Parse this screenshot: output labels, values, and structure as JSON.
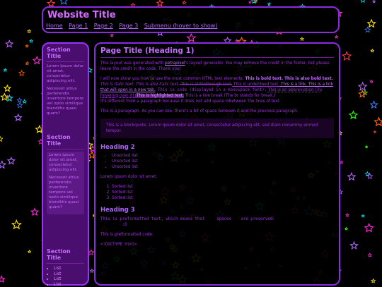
{
  "header": {
    "title": "Website Title",
    "nav": [
      "Home",
      "Page 1",
      "Page 2",
      "Page 3",
      "Submenu (hover to show)"
    ]
  },
  "sidebar": {
    "sections": [
      {
        "title": "Section Title",
        "paragraphs": [
          "Lorem ipsum dolor sit amet, consectetur adipiscing elit.",
          "Necesset altius perferendis inventore tempore vel optio similique blandiitis quasi quam?"
        ]
      },
      {
        "title": "Section Title",
        "paragraphs": [
          "Lorem ipsum dolor sit amet, consectetur adipiscing elit.",
          "Necesset altius perferendis inventore tempore vel optio similique blandiitis quasi quam?"
        ]
      },
      {
        "title": "Section Title",
        "list": [
          "List",
          "List",
          "List",
          "List"
        ]
      }
    ]
  },
  "main": {
    "page_title": "Page Title (Heading 1)",
    "intro": {
      "before": "This layout was generated with ",
      "link": "petrapixel",
      "after": "'s layout generator. You may remove the credit in the footer, but please leave the credit in the code. Thank you!"
    },
    "elements": {
      "lead": "I will now show you how to use the most common HTML text elements: ",
      "bold": "This is bold text.",
      "also_bold": " This is also bold text.",
      "italic": " This is italic text.",
      "also_italic": " This is also italic text.",
      "strike": " This is strikethrough text.",
      "underlined": " This is underlined text.",
      "link": " This is a link.",
      "newtab": " This is a link that will open in a new tab.",
      "code": " This is code (displayed in a monospace font).",
      "abbr": " This is an abbreviation (Try hovering over it).",
      "highlight": " This is highlighted text.",
      "linebreak": " This is a line break (The br stands for break.)",
      "diff": "It's different from a paragraph because it does not add space inbetween the lines of text."
    },
    "paragraph": "This is a paragraph. As you can see, there's a bit of space between it and the previous paragraph.",
    "blockquote": "This is a blockquote. Lorem ipsum dolor sit amet, consectetur adipiscing elit, sed diam nonummy eirmod tempor.",
    "heading2": "Heading 2",
    "unsorted": [
      "Unsorted list",
      "Unsorted list",
      "Unsorted list"
    ],
    "lorem": "Lorem ipsum dolor sit amet.",
    "sorted": [
      "Sorted list",
      "Sorted list",
      "Sorted list"
    ],
    "heading3": "Heading 3",
    "pre": "This is preformatted text, which means that     spaces    are preserved:\n         :D",
    "pre_caption": "This is preformatted code:",
    "code_block": "<!DOCTYPE html>"
  },
  "colors": {
    "background": "#000000",
    "border": "#8a2be2",
    "text": "#9b30d9",
    "title": "#d86bff"
  }
}
